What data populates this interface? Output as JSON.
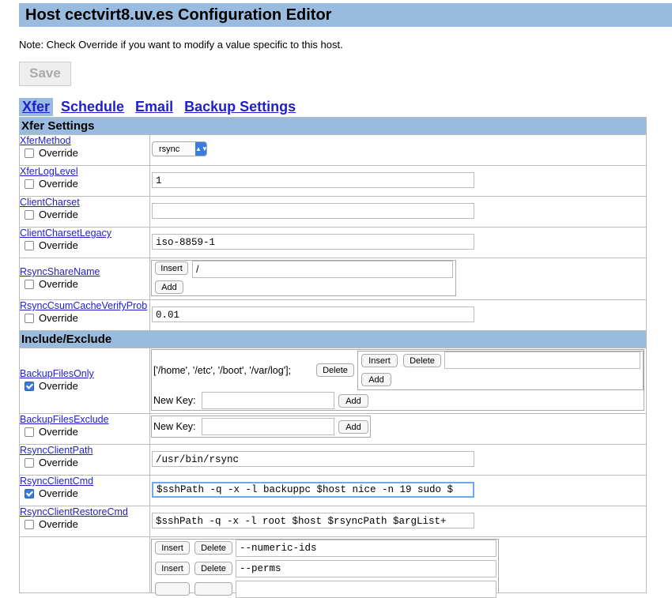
{
  "title": "Host cectvirt8.uv.es Configuration Editor",
  "note": "Note: Check Override if you want to modify a value specific to this host.",
  "save_label": "Save",
  "tabs": [
    "Xfer",
    "Schedule",
    "Email",
    "Backup Settings"
  ],
  "override_label": "Override",
  "insert_label": "Insert",
  "add_label": "Add",
  "delete_label": "Delete",
  "new_key_label": "New Key:",
  "sections": {
    "xfer": "Xfer Settings",
    "include": "Include/Exclude"
  },
  "xfer": {
    "method": {
      "label": "XferMethod",
      "value": "rsync",
      "checked": false
    },
    "loglevel": {
      "label": "XferLogLevel",
      "value": "1",
      "checked": false
    },
    "charset": {
      "label": "ClientCharset",
      "value": "",
      "checked": false
    },
    "charset_legacy": {
      "label": "ClientCharsetLegacy",
      "value": "iso-8859-1",
      "checked": false
    },
    "share": {
      "label": "RsyncShareName",
      "value": "/",
      "checked": false
    },
    "csum": {
      "label": "RsyncCsumCacheVerifyProb",
      "value": "0.01",
      "checked": false
    }
  },
  "include": {
    "files_only": {
      "label": "BackupFilesOnly",
      "value": "['/home', '/etc', '/boot', '/var/log'];",
      "checked": true
    },
    "files_exclude": {
      "label": "BackupFilesExclude",
      "checked": false
    },
    "client_path": {
      "label": "RsyncClientPath",
      "value": "/usr/bin/rsync",
      "checked": false
    },
    "client_cmd": {
      "label": "RsyncClientCmd",
      "value": "$sshPath -q -x -l backuppc $host nice -n 19 sudo $",
      "checked": true
    },
    "restore_cmd": {
      "label": "RsyncClientRestoreCmd",
      "value": "$sshPath -q -x -l root $host $rsyncPath $argList+",
      "checked": false
    },
    "args": [
      "--numeric-ids",
      "--perms"
    ]
  },
  "colors": {
    "header": "#99bbdd",
    "link": "#1f1fcc",
    "check": "#3b7be0"
  }
}
